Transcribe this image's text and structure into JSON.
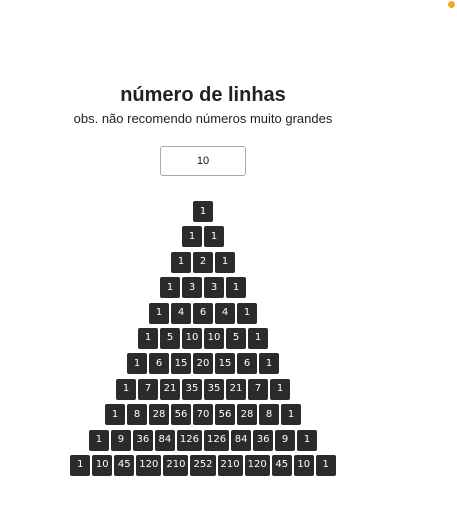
{
  "heading": {
    "title": "número de linhas",
    "subtitle": "obs. não recomendo números muito grandes"
  },
  "lines_input": {
    "value": "10"
  },
  "colors": {
    "cell_background": "#2b2b2b",
    "cell_text": "#ffffff",
    "status_dot": "#f5a623"
  },
  "triangle": [
    [
      1
    ],
    [
      1,
      1
    ],
    [
      1,
      2,
      1
    ],
    [
      1,
      3,
      3,
      1
    ],
    [
      1,
      4,
      6,
      4,
      1
    ],
    [
      1,
      5,
      10,
      10,
      5,
      1
    ],
    [
      1,
      6,
      15,
      20,
      15,
      6,
      1
    ],
    [
      1,
      7,
      21,
      35,
      35,
      21,
      7,
      1
    ],
    [
      1,
      8,
      28,
      56,
      70,
      56,
      28,
      8,
      1
    ],
    [
      1,
      9,
      36,
      84,
      126,
      126,
      84,
      36,
      9,
      1
    ],
    [
      1,
      10,
      45,
      120,
      210,
      252,
      210,
      120,
      45,
      10,
      1
    ]
  ]
}
